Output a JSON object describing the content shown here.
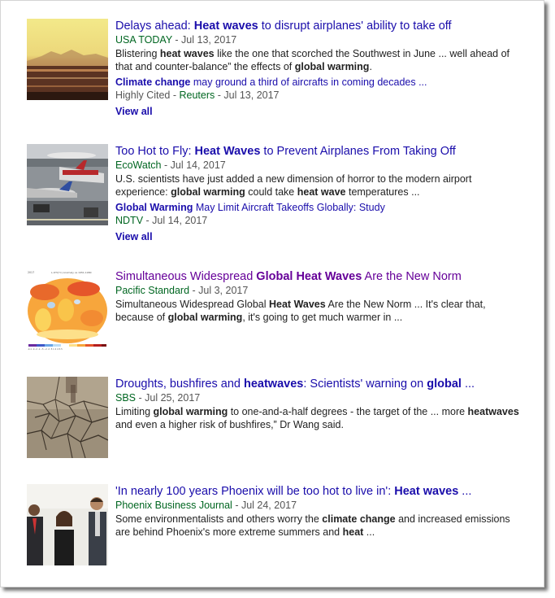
{
  "results": [
    {
      "title": [
        {
          "t": "Delays ahead: ",
          "b": false
        },
        {
          "t": "Heat waves",
          "b": true
        },
        {
          "t": " to disrupt airplanes' ability to take off",
          "b": false
        }
      ],
      "source": "USA TODAY",
      "date": " - Jul 13, 2017",
      "snippet": [
        {
          "t": "Blistering ",
          "b": false
        },
        {
          "t": "heat waves",
          "b": true
        },
        {
          "t": " like the one that scorched the Southwest in June ... well ahead of that and counter-balance” the effects of ",
          "b": false
        },
        {
          "t": "global warming",
          "b": true
        },
        {
          "t": ".",
          "b": false
        }
      ],
      "related_title": [
        {
          "t": "Climate change",
          "b": true
        },
        {
          "t": " may ground a third of aircrafts in coming decades ...",
          "b": false
        }
      ],
      "related_meta_prefix": "Highly Cited - ",
      "related_source": "Reuters",
      "related_date": " - Jul 13, 2017",
      "view_all": "View all",
      "thumbnail_icon": "desert-sunset-image"
    },
    {
      "title": [
        {
          "t": "Too Hot to Fly: ",
          "b": false
        },
        {
          "t": "Heat Waves",
          "b": true
        },
        {
          "t": " to Prevent Airplanes From Taking Off",
          "b": false
        }
      ],
      "source": "EcoWatch",
      "date": " - Jul 14, 2017",
      "snippet": [
        {
          "t": "U.S. scientists have just added a new dimension of horror to the modern airport experience: ",
          "b": false
        },
        {
          "t": "global warming",
          "b": true
        },
        {
          "t": " could take ",
          "b": false
        },
        {
          "t": "heat wave",
          "b": true
        },
        {
          "t": " temperatures ...",
          "b": false
        }
      ],
      "related_title": [
        {
          "t": "Global Warming",
          "b": true
        },
        {
          "t": " May Limit Aircraft Takeoffs Globally: Study",
          "b": false
        }
      ],
      "related_meta_prefix": "",
      "related_source": "NDTV",
      "related_date": " - Jul 14, 2017",
      "view_all": "View all",
      "thumbnail_icon": "airport-planes-image"
    },
    {
      "title": [
        {
          "t": "Simultaneous Widespread ",
          "b": false
        },
        {
          "t": "Global Heat Waves",
          "b": true
        },
        {
          "t": " Are the New Norm",
          "b": false
        }
      ],
      "visited": true,
      "source": "Pacific Standard",
      "date": " - Jul 3, 2017",
      "snippet": [
        {
          "t": "Simultaneous Widespread Global ",
          "b": false
        },
        {
          "t": "Heat Waves",
          "b": true
        },
        {
          "t": " Are the New Norm ... It's clear that, because of ",
          "b": false
        },
        {
          "t": "global warming",
          "b": true
        },
        {
          "t": ", it's going to get much warmer in ...",
          "b": false
        }
      ],
      "thumbnail_icon": "temperature-anomaly-map-image"
    },
    {
      "title": [
        {
          "t": "Droughts, bushfires and ",
          "b": false
        },
        {
          "t": "heatwaves",
          "b": true
        },
        {
          "t": ": Scientists' warning on ",
          "b": false
        },
        {
          "t": "global",
          "b": true
        },
        {
          "t": " ...",
          "b": false
        }
      ],
      "source": "SBS",
      "date": " - Jul 25, 2017",
      "snippet": [
        {
          "t": "Limiting ",
          "b": false
        },
        {
          "t": "global warming",
          "b": true
        },
        {
          "t": " to one-and-a-half degrees - the target of the ... more ",
          "b": false
        },
        {
          "t": "heatwaves",
          "b": true
        },
        {
          "t": " and even a higher risk of bushfires,” Dr Wang said.",
          "b": false
        }
      ],
      "thumbnail_icon": "cracked-earth-image"
    },
    {
      "title": [
        {
          "t": "'In nearly 100 years Phoenix will be too hot to live in': ",
          "b": false
        },
        {
          "t": "Heat waves",
          "b": true
        },
        {
          "t": " ...",
          "b": false
        }
      ],
      "source": "Phoenix Business Journal",
      "date": " - Jul 24, 2017",
      "snippet": [
        {
          "t": "Some environmentalists and others worry the ",
          "b": false
        },
        {
          "t": "climate change",
          "b": true
        },
        {
          "t": " and increased emissions are behind Phoenix's more extreme summers and ",
          "b": false
        },
        {
          "t": "heat",
          "b": true
        },
        {
          "t": " ...",
          "b": false
        }
      ],
      "thumbnail_icon": "people-group-photo-image"
    }
  ],
  "thumbnail_map_text": {
    "header": "L-OTI(°C) Anomaly vs 1951-1980",
    "year": "2017",
    "scale": "-4.1 -4 -2 -1 -.5 -.2 .2 .5 1 2 4 5.5"
  },
  "colors": {
    "link": "#1a0dab",
    "visited": "#660099",
    "source": "#006621",
    "meta": "#555555",
    "snippet": "#222222"
  }
}
